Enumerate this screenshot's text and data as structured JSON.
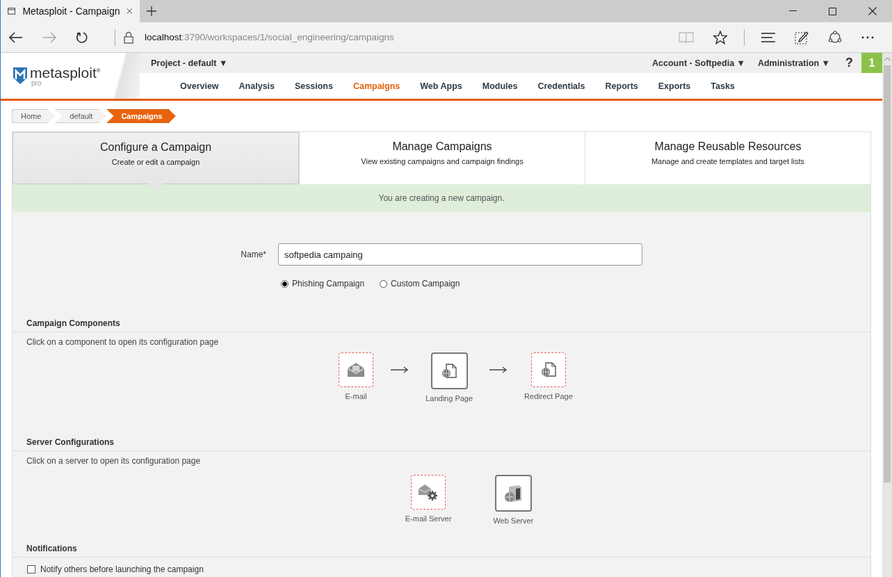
{
  "browser": {
    "tab_title": "Metasploit - Campaign",
    "url_host": "localhost",
    "url_path": ":3790/workspaces/1/social_engineering/campaigns"
  },
  "header": {
    "logo": "metasploit$^{®}$",
    "logo_sub": "pro",
    "project_menu": "Project - default ▼",
    "account_menu": "Account - Softpedia ▼",
    "admin_menu": "Administration ▼",
    "help": "?",
    "notification_count": "1"
  },
  "nav": [
    {
      "label": "Overview",
      "selected": false
    },
    {
      "label": "Analysis",
      "selected": false
    },
    {
      "label": "Sessions",
      "selected": false
    },
    {
      "label": "Campaigns",
      "selected": true
    },
    {
      "label": "Web Apps",
      "selected": false
    },
    {
      "label": "Modules",
      "selected": false
    },
    {
      "label": "Credentials",
      "selected": false
    },
    {
      "label": "Reports",
      "selected": false
    },
    {
      "label": "Exports",
      "selected": false
    },
    {
      "label": "Tasks",
      "selected": false
    }
  ],
  "breadcrumb": [
    {
      "label": "Home",
      "selected": false
    },
    {
      "label": "default",
      "selected": false
    },
    {
      "label": "Campaigns",
      "selected": true
    }
  ],
  "steps": [
    {
      "title": "Configure a Campaign",
      "subtitle": "Create or edit a campaign",
      "selected": true
    },
    {
      "title": "Manage Campaigns",
      "subtitle": "View existing campaigns and campaign findings",
      "selected": false
    },
    {
      "title": "Manage Reusable Resources",
      "subtitle": "Manage and create templates and target lists",
      "selected": false
    }
  ],
  "banner": "You are creating a new campaign.",
  "form": {
    "name_label": "Name*",
    "name_value": "softpedia campaing",
    "campaign_types": [
      {
        "label": "Phishing Campaign",
        "selected": true
      },
      {
        "label": "Custom Campaign",
        "selected": false
      }
    ]
  },
  "sections": [
    {
      "heading": "Campaign Components",
      "hint": "Click on a component to open its configuration page",
      "flow": true,
      "items": [
        {
          "label": "E-mail",
          "kind": "email",
          "configured": false
        },
        {
          "label": "Landing Page",
          "kind": "page",
          "configured": true
        },
        {
          "label": "Redirect Page",
          "kind": "page",
          "configured": false
        }
      ]
    },
    {
      "heading": "Server Configurations",
      "hint": "Click on a server to open its configuration page",
      "flow": false,
      "items": [
        {
          "label": "E-mail Server",
          "kind": "mailserver",
          "configured": false
        },
        {
          "label": "Web Server",
          "kind": "webserver",
          "configured": true
        }
      ]
    }
  ],
  "notifications": {
    "heading": "Notifications",
    "option": {
      "label": "Notify others before launching the campaign",
      "checked": false
    }
  }
}
